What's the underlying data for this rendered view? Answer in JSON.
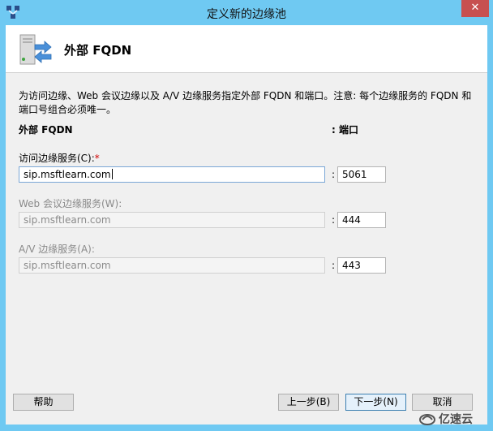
{
  "window": {
    "title": "定义新的边缘池",
    "close_glyph": "✕"
  },
  "header": {
    "title": "外部 FQDN",
    "icon": "server-arrows-icon"
  },
  "description": "为访问边缘、Web 会议边缘以及 A/V 边缘服务指定外部 FQDN 和端口。注意: 每个边缘服务的 FQDN 和端口号组合必须唯一。",
  "columns": {
    "fqdn": "外部 FQDN",
    "port": ": 端口"
  },
  "fields": [
    {
      "label": "访问边缘服务(C):",
      "required_mark": "*",
      "value": "sip.msftlearn.com",
      "colon": ":",
      "port": "5061",
      "enabled": true
    },
    {
      "label": "Web 会议边缘服务(W):",
      "value": "sip.msftlearn.com",
      "colon": ":",
      "port": "444",
      "enabled": false
    },
    {
      "label": "A/V 边缘服务(A):",
      "value": "sip.msftlearn.com",
      "colon": ":",
      "port": "443",
      "enabled": false
    }
  ],
  "buttons": {
    "help": "帮助",
    "back": "上一步(B)",
    "next": "下一步(N)",
    "cancel": "取消"
  },
  "watermark": {
    "text": "亿速云",
    "icon": "yisu-logo-icon"
  },
  "colors": {
    "titlebar": "#6fc9f2",
    "close": "#c75050",
    "required": "#d00000"
  }
}
